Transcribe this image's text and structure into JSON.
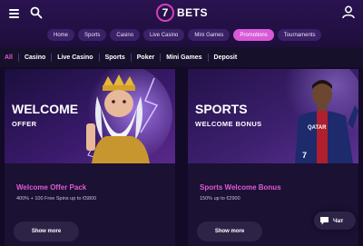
{
  "header": {
    "logo_number": "7",
    "logo_text": "BETS",
    "menu_icon": "hamburger-icon",
    "search_icon": "search-icon",
    "user_icon": "user-icon",
    "nav": [
      "Home",
      "Sports",
      "Casino",
      "Live Casino",
      "Mini Games",
      "Promotions",
      "Tournaments"
    ],
    "active_nav": "Promotions"
  },
  "filters": [
    "All",
    "Casino",
    "Live Casino",
    "Sports",
    "Poker",
    "Mini Games",
    "Deposit"
  ],
  "cards": [
    {
      "headline": "WELCOME",
      "subhead": "OFFER",
      "title": "Welcome Offer Pack",
      "desc": "400% + 100 Free Spins up to €5800",
      "button": "Show more"
    },
    {
      "headline": "SPORTS",
      "subhead": "WELCOME BONUS",
      "title": "Sports Welcome Bonus",
      "desc": "150% up to €2900",
      "button": "Show more",
      "jersey_sponsor": "QATAR",
      "jersey_number": "7"
    }
  ],
  "chat": {
    "label": "Чат",
    "icon": "chat-bubble-icon"
  },
  "colors": {
    "accent": "#e05ad6",
    "background": "#120a26",
    "card": "#1a1133"
  }
}
